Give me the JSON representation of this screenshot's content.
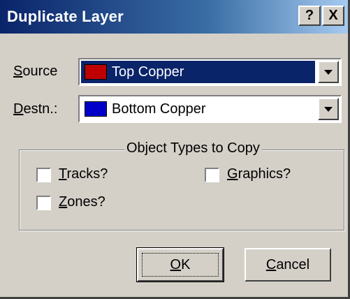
{
  "window": {
    "title": "Duplicate Layer",
    "help_glyph": "?",
    "close_glyph": "X"
  },
  "source": {
    "label_mnemonic": "S",
    "label_rest": "ource",
    "value": "Top Copper",
    "swatch_color": "#c00000"
  },
  "destination": {
    "label_mnemonic": "D",
    "label_rest": "estn.:",
    "value": "Bottom Copper",
    "swatch_color": "#0000c8"
  },
  "object_types": {
    "legend": "Object Types to Copy",
    "tracks": {
      "mnemonic": "T",
      "rest": "racks?",
      "checked": false
    },
    "graphics": {
      "mnemonic": "G",
      "rest": "raphics?",
      "checked": false
    },
    "zones": {
      "mnemonic": "Z",
      "rest": "ones?",
      "checked": false
    }
  },
  "buttons": {
    "ok": {
      "mnemonic": "O",
      "rest": "K"
    },
    "cancel": {
      "mnemonic": "C",
      "rest": "ancel"
    }
  },
  "colors": {
    "dialog_face": "#d4d0c8",
    "title_active": "#0a246a",
    "selection": "#0a246a"
  }
}
